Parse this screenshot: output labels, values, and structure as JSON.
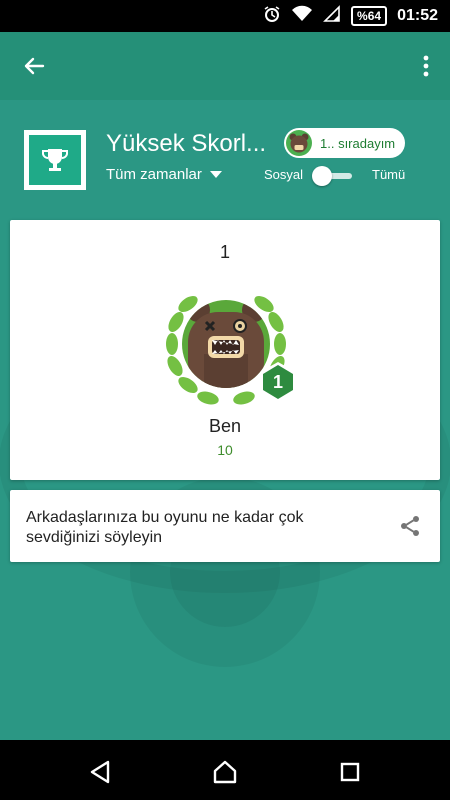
{
  "status_bar": {
    "battery": "%64",
    "time": "01:52"
  },
  "header": {
    "title": "Yüksek Skorl...",
    "time_filter": "Tüm zamanlar",
    "rank_label": "1.. sıradayım",
    "toggle": {
      "left_label": "Sosyal",
      "right_label": "Tümü",
      "state": "Sosyal"
    }
  },
  "leaderboard": {
    "entries": [
      {
        "rank": "1",
        "badge_rank": "1",
        "name": "Ben",
        "score": "10"
      }
    ]
  },
  "share": {
    "text": "Arkadaşlarınıza bu oyunu ne kadar çok sevdiğinizi söyleyin"
  },
  "colors": {
    "background": "#2b9784",
    "toolbar": "#259078",
    "accent": "#1faa88",
    "badge": "#2e8b3f"
  }
}
